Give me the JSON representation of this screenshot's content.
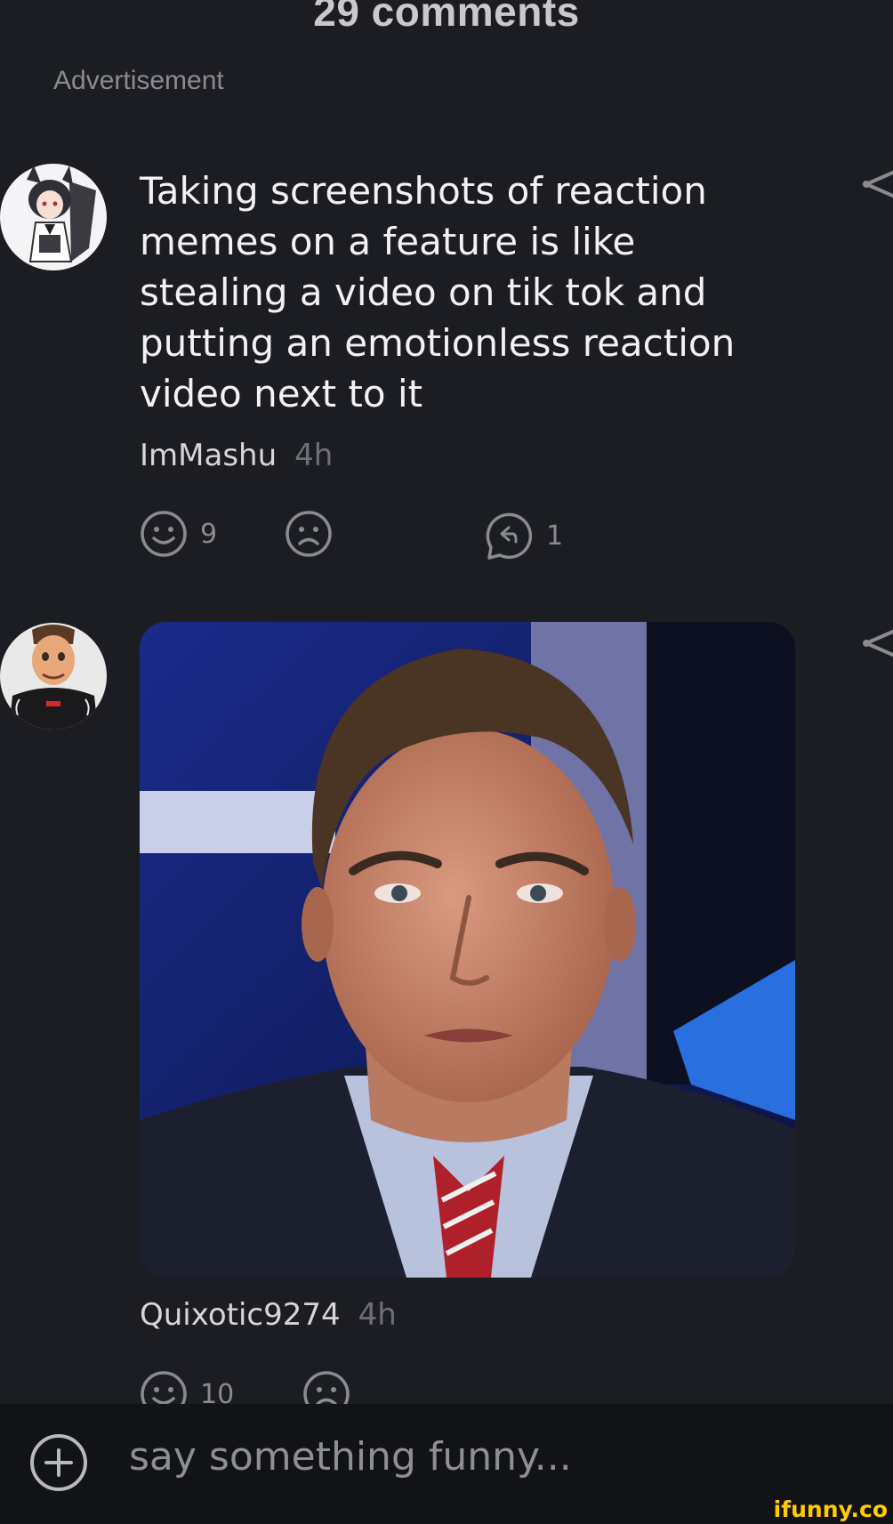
{
  "header": {
    "title": "29 comments",
    "ad_label": "Advertisement"
  },
  "comments": [
    {
      "text": "Taking screenshots of reaction memes on a feature is like stealing a video on tik tok and putting an emotionless reaction video next to it",
      "author": "ImMashu",
      "time": "4h",
      "smile_count": "9",
      "reply_count": "1",
      "icons": [
        "avatar-anime-fox",
        "smile-icon",
        "frown-icon",
        "reply-icon",
        "share-icon"
      ]
    },
    {
      "author": "Quixotic9274",
      "time": "4h",
      "smile_count": "10",
      "icons": [
        "avatar-toy-figure",
        "smile-icon",
        "frown-icon",
        "share-icon"
      ],
      "image": "reaction-meme-face"
    }
  ],
  "composer": {
    "placeholder": "say something funny..."
  },
  "watermark": "ifunny.co",
  "colors": {
    "background": "#1c1d22",
    "input_bar": "#121317",
    "muted": "#8a8b90",
    "watermark": "#ffcc00"
  }
}
